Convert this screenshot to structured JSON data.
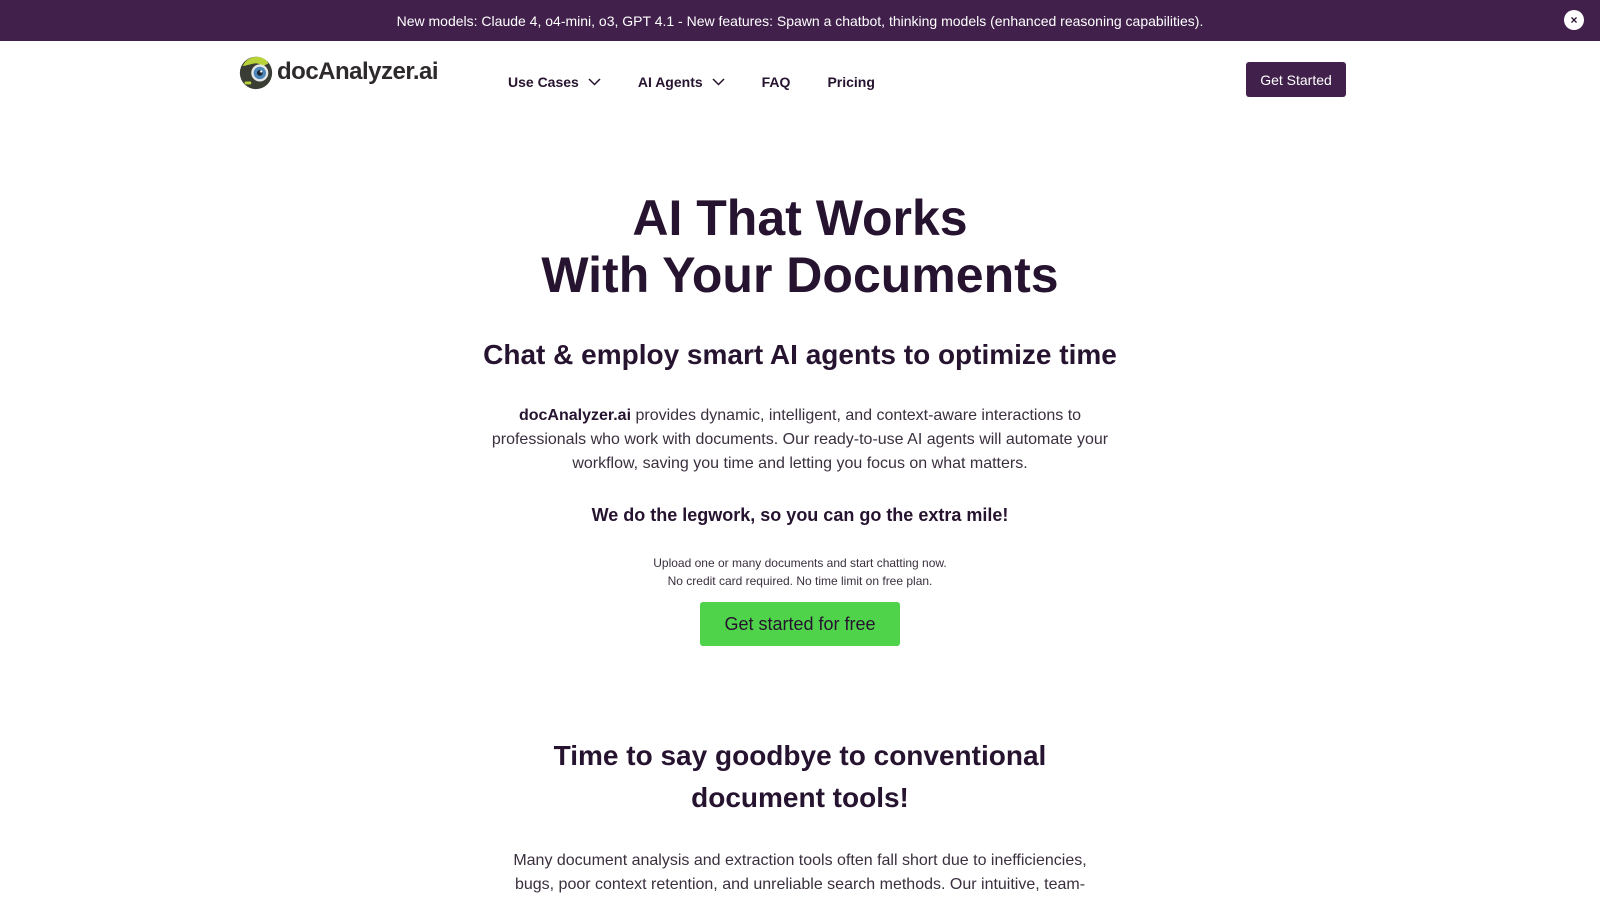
{
  "banner": {
    "text": "New models: Claude 4, o4-mini, o3, GPT 4.1 - New features: Spawn a chatbot, thinking models (enhanced reasoning capabilities).",
    "close_glyph": "×"
  },
  "header": {
    "logo_text": "docAnalyzer.ai",
    "nav": [
      {
        "label": "Use Cases",
        "has_dropdown": true
      },
      {
        "label": "AI Agents",
        "has_dropdown": true
      },
      {
        "label": "FAQ",
        "has_dropdown": false
      },
      {
        "label": "Pricing",
        "has_dropdown": false
      }
    ],
    "cta_label": "Get Started"
  },
  "hero": {
    "title_line1": "AI That Works",
    "title_line2": "With Your Documents",
    "subtitle": "Chat & employ smart AI agents to optimize time",
    "desc_brand": "docAnalyzer.ai",
    "desc_rest": " provides dynamic, intelligent, and context-aware interactions to professionals who work with documents. Our ready-to-use AI agents will automate your workflow, saving you time and letting you focus on what matters.",
    "tagline": "We do the legwork, so you can go the extra mile!",
    "note_line1": "Upload one or many documents and start chatting now.",
    "note_line2": "No credit card required. No time limit on free plan.",
    "cta_label": "Get started for free"
  },
  "section": {
    "title": "Time to say goodbye to conventional document tools!",
    "body": "Many document analysis and extraction tools often fall short due to inefficiencies, bugs, poor context retention, and unreliable search methods. Our intuitive, team-"
  },
  "colors": {
    "brand_purple": "#41204b",
    "text_dark": "#26132f",
    "cta_green": "#4ed34a"
  },
  "icons": {
    "logo": "robot-eye-logo-icon",
    "dropdown": "chevron-down-icon",
    "close": "close-icon"
  }
}
